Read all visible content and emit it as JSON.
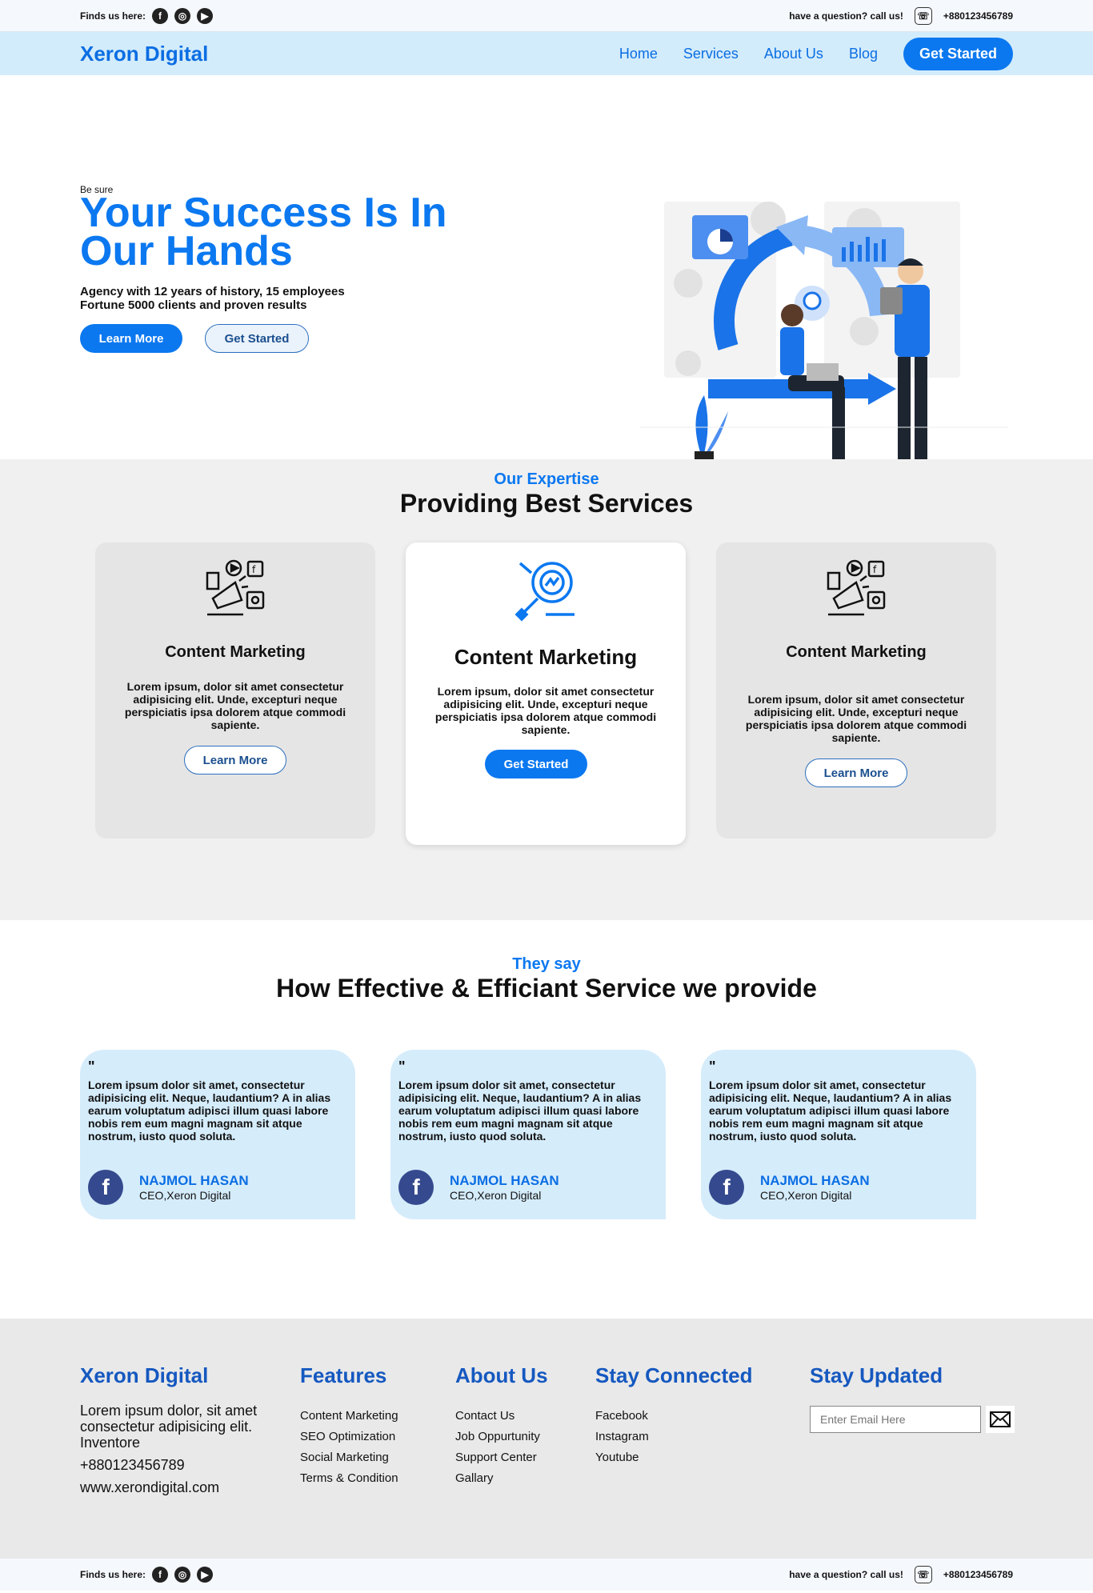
{
  "topbar": {
    "find_us": "Finds us here:",
    "question": "have a question? call us!",
    "phone": "+880123456789"
  },
  "nav": {
    "logo": "Xeron Digital",
    "links": [
      "Home",
      "Services",
      "About Us",
      "Blog"
    ],
    "cta": "Get Started"
  },
  "hero": {
    "eyebrow": "Be sure",
    "title": "Your Success Is In Our Hands",
    "subtitle": "Agency with 12 years of history, 15 employees Fortune 5000 clients and proven results",
    "btn_learn": "Learn More",
    "btn_start": "Get Started"
  },
  "services": {
    "eyebrow": "Our Expertise",
    "title": "Providing Best Services",
    "cards": [
      {
        "title": "Content Marketing",
        "desc": "Lorem ipsum, dolor sit amet consectetur adipisicing elit. Unde, excepturi neque perspiciatis ipsa dolorem atque commodi sapiente.",
        "button": "Learn More"
      },
      {
        "title": "Content Marketing",
        "desc": "Lorem ipsum, dolor sit amet consectetur adipisicing elit. Unde, excepturi neque perspiciatis ipsa dolorem atque commodi sapiente.",
        "button": "Get Started"
      },
      {
        "title": "Content Marketing",
        "desc": "Lorem ipsum, dolor sit amet consectetur adipisicing elit. Unde, excepturi neque perspiciatis ipsa dolorem atque commodi sapiente.",
        "button": "Learn More"
      }
    ]
  },
  "testimonials": {
    "eyebrow": "They say",
    "title": "How Effective & Efficiant Service we provide",
    "quote_mark": "\"",
    "items": [
      {
        "text": "Lorem ipsum dolor sit amet, consectetur adipisicing elit. Neque, laudantium? A in alias earum voluptatum adipisci illum quasi labore nobis rem eum magni magnam sit atque nostrum, iusto quod soluta.",
        "name": "NAJMOL HASAN",
        "role": "CEO,Xeron Digital"
      },
      {
        "text": "Lorem ipsum dolor sit amet, consectetur adipisicing elit. Neque, laudantium? A in alias earum voluptatum adipisci illum quasi labore nobis rem eum magni magnam sit atque nostrum, iusto quod soluta.",
        "name": "NAJMOL HASAN",
        "role": "CEO,Xeron Digital"
      },
      {
        "text": "Lorem ipsum dolor sit amet, consectetur adipisicing elit. Neque, laudantium? A in alias earum voluptatum adipisci illum quasi labore nobis rem eum magni magnam sit atque nostrum, iusto quod soluta.",
        "name": "NAJMOL HASAN",
        "role": "CEO,Xeron Digital"
      }
    ]
  },
  "footer": {
    "brand": "Xeron Digital",
    "brand_text": "Lorem ipsum dolor, sit amet consectetur adipisicing elit. Inventore",
    "phone": "+880123456789",
    "website": "www.xerondigital.com",
    "features_title": "Features",
    "features": [
      "Content Marketing",
      "SEO Optimization",
      "Social Marketing",
      "Terms & Condition"
    ],
    "about_title": "About Us",
    "about": [
      "Contact Us",
      "Job Oppurtunity",
      "Support Center",
      "Gallary"
    ],
    "connected_title": "Stay Connected",
    "connected": [
      "Facebook",
      "Instagram",
      "Youtube"
    ],
    "updated_title": "Stay Updated",
    "email_placeholder": "Enter Email Here"
  },
  "bottombar": {
    "find_us": "Finds us here:",
    "question": "have a question? call us!",
    "phone": "+880123456789"
  },
  "colors": {
    "accent": "#0b78f0",
    "nav_bg": "#d3ecfb",
    "footer_title": "#1558c0"
  }
}
